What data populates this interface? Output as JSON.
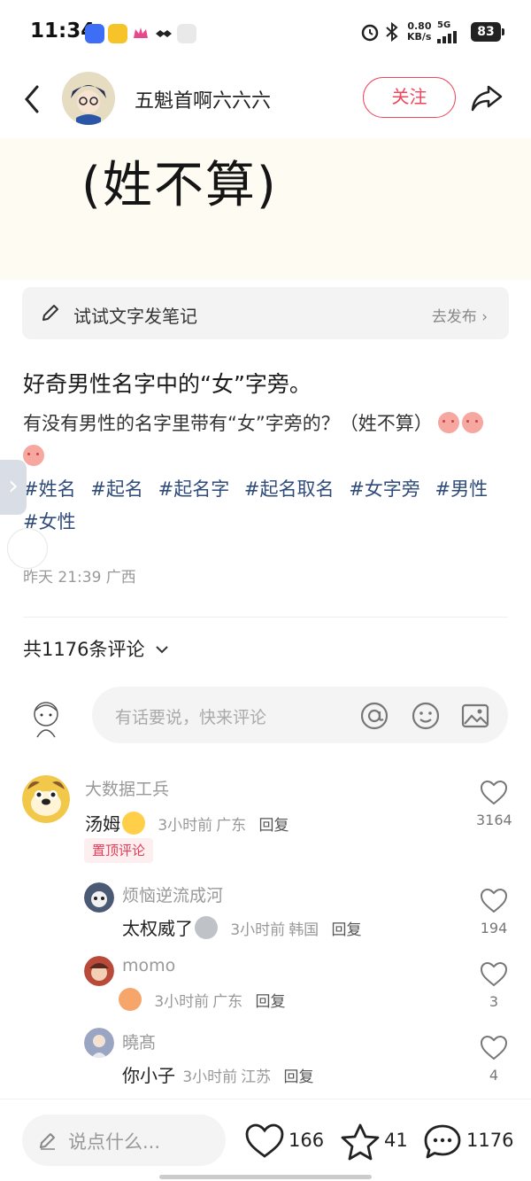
{
  "status_bar": {
    "time": "11:34",
    "network_speed_value": "0.80",
    "network_speed_unit": "KB/s",
    "network_type": "5G",
    "battery": "83"
  },
  "header": {
    "author": "五魁首啊六六六",
    "follow_label": "关注"
  },
  "banner": {
    "text": "(姓不算)"
  },
  "try_note": {
    "label": "试试文字发笔记",
    "action": "去发布 ›"
  },
  "post": {
    "title": "好奇男性名字中的“女”字旁。",
    "body": "有没有男性的名字里带有“女”字旁的？（姓不算）",
    "tags": [
      "#姓名",
      "#起名",
      "#起名字",
      "#起名取名",
      "#女字旁",
      "#男性",
      "#女性"
    ],
    "meta": "昨天 21:39 广西"
  },
  "comments_section": {
    "count_label": "共1176条评论",
    "input_placeholder": "有话要说，快来评论"
  },
  "comments": [
    {
      "name": "大数据工兵",
      "text": "汤姆",
      "time": "3小时前",
      "location": "广东",
      "reply": "回复",
      "likes": "3164",
      "pin_label": "置顶评论"
    },
    {
      "name": "烦恼逆流成河",
      "text": "太权威了",
      "time": "3小时前",
      "location": "韩国",
      "reply": "回复",
      "likes": "194"
    },
    {
      "name": "momo",
      "text": "",
      "time": "3小时前",
      "location": "广东",
      "reply": "回复",
      "likes": "3"
    },
    {
      "name": "曉髙",
      "text": "你小子",
      "time": "3小时前",
      "location": "江苏",
      "reply": "回复",
      "likes": "4"
    }
  ],
  "bottom_bar": {
    "say_placeholder": "说点什么...",
    "likes": "166",
    "favorites": "41",
    "comments": "1176"
  },
  "colors": {
    "accent": "#f0465d",
    "tag": "#2f4b7a",
    "muted": "#999999"
  }
}
